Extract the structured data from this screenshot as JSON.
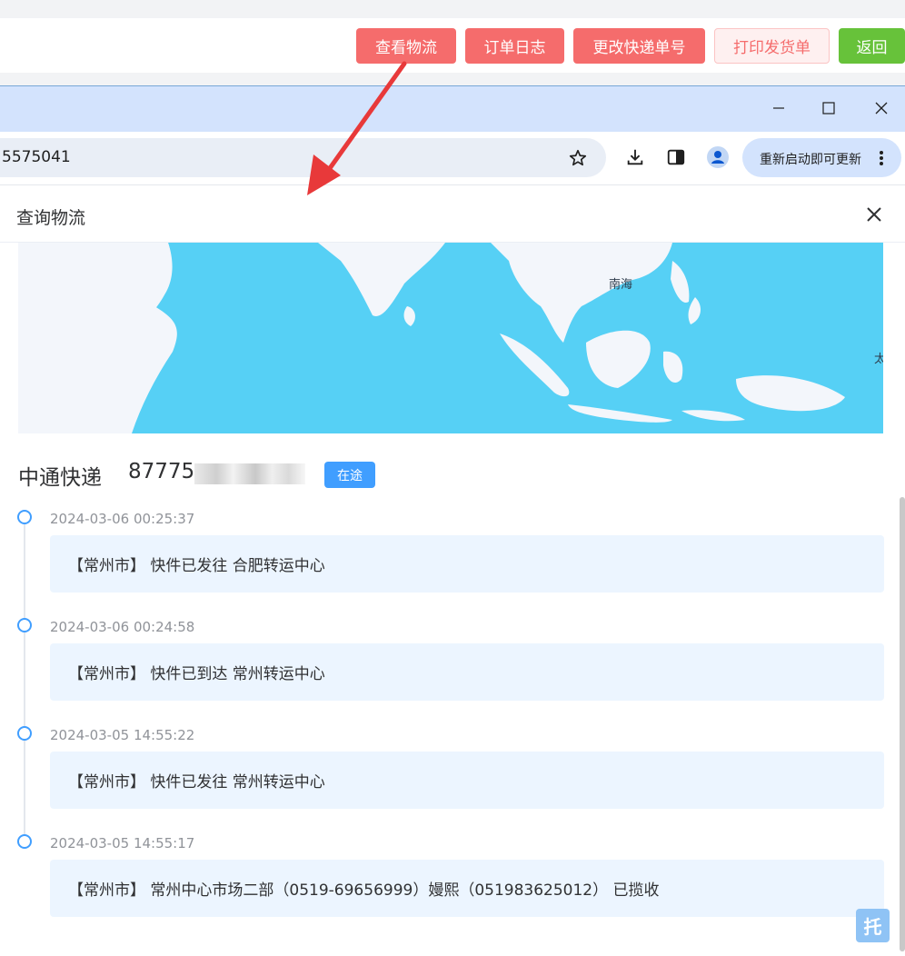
{
  "app_toolbar": {
    "buttons": [
      "查看物流",
      "订单日志",
      "更改快递单号",
      "打印发货单",
      "返回"
    ]
  },
  "browser": {
    "address_text": "5575041",
    "update_button": "重新启动即可更新"
  },
  "dialog": {
    "title": "查询物流",
    "map_label_sea": "南海",
    "map_label_edge": "太"
  },
  "shipment": {
    "courier": "中通快递",
    "tracking_prefix": "87775",
    "tracking_start": "7",
    "status": "在途"
  },
  "timeline": [
    {
      "time": "2024-03-06 00:25:37",
      "text": "【常州市】 快件已发往 合肥转运中心"
    },
    {
      "time": "2024-03-06 00:24:58",
      "text": "【常州市】 快件已到达 常州转运中心"
    },
    {
      "time": "2024-03-05 14:55:22",
      "text": "【常州市】 快件已发往 常州转运中心"
    },
    {
      "time": "2024-03-05 14:55:17",
      "text": "【常州市】 常州中心市场二部（0519-69656999）嫚熙（051983625012） 已揽收"
    }
  ],
  "float_button": "托",
  "colors": {
    "danger": "#f56c6c",
    "success": "#67c23a",
    "primary": "#409eff",
    "window_title": "#d3e3fd",
    "sea": "#56d0f5",
    "annotation_arrow": "#e8393a"
  }
}
